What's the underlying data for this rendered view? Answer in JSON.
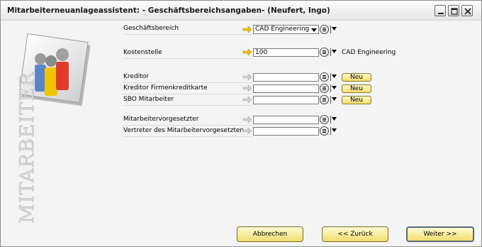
{
  "window": {
    "title": "Mitarbeiterneuanlageassistent:  - Geschäftsbereichsangaben- (Neufert, Ingo)",
    "controls": [
      "minimize-icon",
      "maximize-icon",
      "close-icon"
    ]
  },
  "logo": {
    "vertical_text": "MITARBEITER"
  },
  "form": {
    "rows": [
      {
        "label": "Geschäftsbereich",
        "value": "CAD Engineering",
        "kind": "combo"
      },
      {
        "label": "Kostenstelle",
        "value": "100",
        "side_text": "CAD Engineering"
      },
      {
        "label": "Kreditor",
        "value": "",
        "neu": "Neu"
      },
      {
        "label": "Kreditor Firmenkreditkarte",
        "value": "",
        "neu": "Neu"
      },
      {
        "label": "SBO Mitarbeiter",
        "value": "",
        "neu": "Neu"
      },
      {
        "label": "Mitarbeitervorgesetzter",
        "value": ""
      },
      {
        "label": "Vertreter des Mitarbeitervorgesetzten",
        "value": ""
      }
    ]
  },
  "buttons": {
    "cancel": "Abbrechen",
    "back": "<< Zurück",
    "next": "Weiter >>"
  },
  "colors": {
    "button_fill": "#f2dc6f",
    "link_arrow_active": "#f2c200",
    "link_arrow_inactive": "#c8c8c8"
  }
}
